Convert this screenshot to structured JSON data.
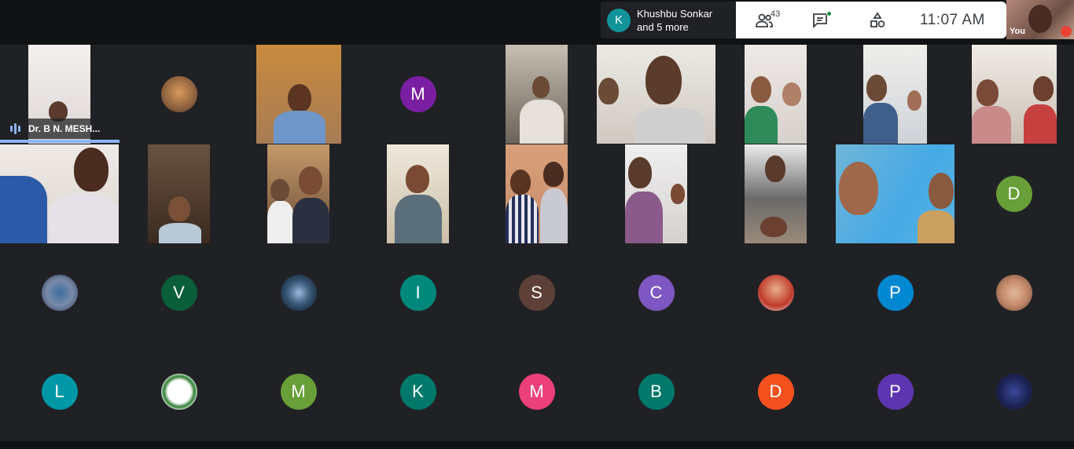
{
  "window": {
    "title": ""
  },
  "toast": {
    "avatar_letter": "K",
    "line1": "Khushbu Sonkar",
    "line2": "and 5 more"
  },
  "toolbar": {
    "people_count": "43",
    "time": "11:07  AM"
  },
  "self": {
    "label": "You"
  },
  "speaker": {
    "name": "Dr. B N. MESH..."
  },
  "avatars": [
    {
      "letter": "M",
      "color": "#7b1fa2"
    },
    {
      "letter": "D",
      "color": "#689f38"
    },
    {
      "letter": "V",
      "color": "#0b5e3a"
    },
    {
      "letter": "I",
      "color": "#00897b"
    },
    {
      "letter": "S",
      "color": "#5d4037"
    },
    {
      "letter": "C",
      "color": "#7e57c2"
    },
    {
      "letter": "P",
      "color": "#0288d1"
    },
    {
      "letter": "L",
      "color": "#0097a7"
    },
    {
      "letter": "M",
      "color": "#689f38"
    },
    {
      "letter": "K",
      "color": "#00796b"
    },
    {
      "letter": "M",
      "color": "#ec407a"
    },
    {
      "letter": "B",
      "color": "#00796b"
    },
    {
      "letter": "D",
      "color": "#f4511e"
    },
    {
      "letter": "P",
      "color": "#5e35b1"
    }
  ],
  "icons": {
    "people": "people-icon",
    "chat": "chat-icon",
    "activities": "activities-icon",
    "mic_off": "mic-off-icon",
    "audio": "audio-level-icon"
  },
  "colors": {
    "background": "#202124",
    "accent": "#8ab4f8",
    "toolbar_bg": "#ffffff"
  }
}
